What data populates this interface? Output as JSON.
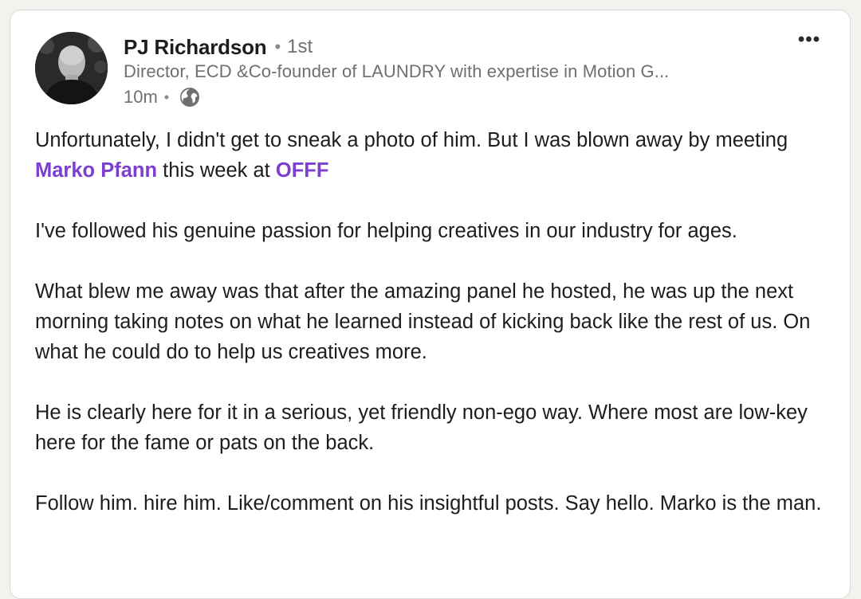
{
  "post": {
    "author": {
      "name": "PJ Richardson",
      "degree": "1st",
      "headline": "Director, ECD &Co-founder of LAUNDRY with expertise in Motion G...",
      "time": "10m",
      "visibility_icon": "globe-icon",
      "avatar": "profile-photo"
    },
    "menu_icon": "more-horizontal-icon",
    "paragraphs": [
      {
        "before": "Unfortunately, I didn't get to sneak a photo of him. But I was blown away by meeting ",
        "mention1": "Marko Pfann",
        "middle": " this week at ",
        "mention2": "OFFF"
      },
      {
        "text": "I've followed his genuine passion for helping creatives in our industry for ages."
      },
      {
        "text": "What blew me away was that after the amazing panel he hosted, he was up the next morning taking notes on what he learned instead of kicking back like the rest of us. On what he could do to help us creatives more."
      },
      {
        "text": "He is clearly here for it in a serious, yet friendly non-ego way. Where most are low-key here for the fame or pats on the back."
      },
      {
        "text": "Follow him. hire him. Like/comment on his insightful posts. Say hello. Marko is the man."
      }
    ]
  },
  "colors": {
    "mention": "#7b3fd1",
    "text": "#1d1d1d",
    "muted": "#6f6f6f",
    "background": "#f3f2ef",
    "card": "#ffffff"
  }
}
